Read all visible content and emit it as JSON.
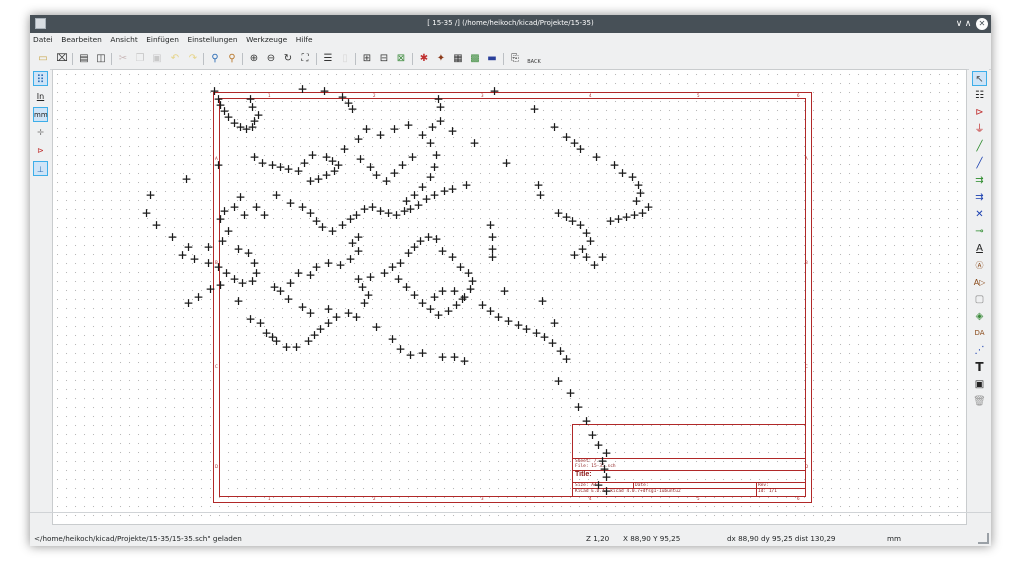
{
  "window": {
    "title": "[ 15-35 /] (/home/heikoch/kicad/Projekte/15-35)",
    "minimize": "∨",
    "maximize": "∧",
    "close": "✕"
  },
  "menu": [
    "Datei",
    "Bearbeiten",
    "Ansicht",
    "Einfügen",
    "Einstellungen",
    "Werkzeuge",
    "Hilfe"
  ],
  "toolbar": {
    "icons": [
      "new-schematic-icon",
      "open-icon",
      "save-icon",
      "page-settings-icon",
      "print-icon",
      "cut-icon",
      "copy-icon",
      "paste-icon",
      "undo-icon",
      "redo-icon",
      "find-icon",
      "find-replace-icon",
      "zoom-in-icon",
      "zoom-out-icon",
      "zoom-redraw-icon",
      "zoom-fit-icon",
      "hierarchy-icon",
      "leave-sheet-icon",
      "library-editor-icon",
      "library-browser-icon",
      "annotate-icon",
      "erc-icon",
      "netlist-icon",
      "bom-icon",
      "footprint-assign-icon",
      "cvpcb-icon",
      "pcbnew-icon",
      "back-annotate-icon"
    ],
    "back_label": "BACK"
  },
  "left_toolbar": {
    "grid_icon": "grid-icon",
    "in_label": "In",
    "mm_label": "mm",
    "icons": [
      "grid-icon",
      "inch-units-icon",
      "mm-units-icon",
      "cursor-shape-icon",
      "hidden-pins-icon",
      "bus-wire-angle-icon"
    ]
  },
  "right_toolbar": {
    "icons": [
      "select-arrow-icon",
      "hierarchy-navigator-icon",
      "add-component-icon",
      "add-power-icon",
      "add-wire-icon",
      "add-bus-icon",
      "wire-entry-icon",
      "bus-entry-icon",
      "no-connect-icon",
      "add-junction-icon",
      "net-label-icon",
      "global-label-icon",
      "hierarchical-label-icon",
      "hierarchical-sheet-icon",
      "import-sheet-pin-icon",
      "add-sheet-pin-icon",
      "add-graphic-line-icon",
      "add-text-icon",
      "add-image-icon",
      "delete-icon"
    ],
    "text_glyph": "T",
    "label_glyph": "A",
    "net_glyph": "DA"
  },
  "canvas": {
    "mark_glyph": "+",
    "edge_numbers_top": [
      "1",
      "2",
      "3",
      "4",
      "5",
      "6"
    ],
    "edge_numbers_side": [
      "A",
      "B",
      "C",
      "D"
    ],
    "title_block": {
      "sheet": "Sheet: /",
      "file": "File: 15-35.sch",
      "title": "Title:",
      "size": "Size: A4",
      "date": "Date:",
      "rev": "Rev:",
      "kicad": "KiCad E.D.A.  kicad 4.0.7+dfsg1-1ubuntu2",
      "id": "Id: 1/1"
    }
  },
  "status": {
    "message": "</home/heikoch/kicad/Projekte/15-35/15-35.sch\" geladen",
    "zoom": "Z 1,20",
    "xy": "X 88,90  Y 95,25",
    "dxy": "dx 88,90  dy 95,25  dist 130,29",
    "units": "mm"
  },
  "colors": {
    "sheet_border": "#b02828",
    "titlebar": "#475057",
    "accent": "#3daee9",
    "marks": "#1a1a1a"
  }
}
